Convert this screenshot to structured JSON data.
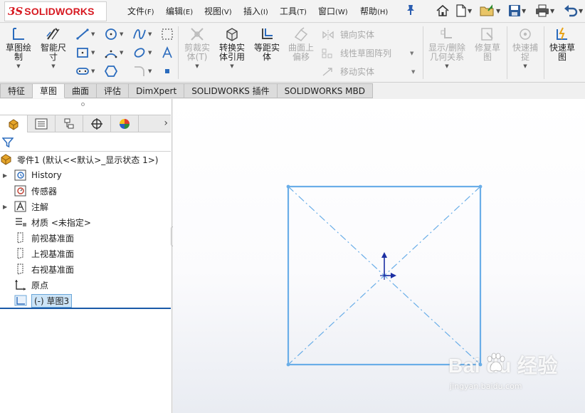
{
  "app": {
    "brand_prefix": "3S",
    "brand": "SOLIDWORKS"
  },
  "menu": [
    {
      "label": "文件",
      "accel": "(F)"
    },
    {
      "label": "编辑",
      "accel": "(E)"
    },
    {
      "label": "视图",
      "accel": "(V)"
    },
    {
      "label": "插入",
      "accel": "(I)"
    },
    {
      "label": "工具",
      "accel": "(T)"
    },
    {
      "label": "窗口",
      "accel": "(W)"
    },
    {
      "label": "帮助",
      "accel": "(H)"
    }
  ],
  "ribbon": {
    "sketch": "草图绘\n制",
    "smart_dim": "智能尺\n寸",
    "trim": "剪裁实\n体(T)",
    "convert": "转换实\n体引用",
    "offset": "等距实\n体",
    "offset_surface": "曲面上\n偏移",
    "mirror": "镜向实体",
    "linear_pattern": "线性草图阵列",
    "move": "移动实体",
    "display_delete": "显示/删除\n几何关系",
    "repair": "修复草\n图",
    "quick_snap": "快速捕\n捉",
    "rapid_sketch": "快速草\n图"
  },
  "tabs": [
    "特征",
    "草图",
    "曲面",
    "评估",
    "DimXpert",
    "SOLIDWORKS 插件",
    "SOLIDWORKS MBD"
  ],
  "active_tab": "草图",
  "tree": {
    "root": "零件1  (默认<<默认>_显示状态 1>)",
    "items": [
      {
        "label": "History",
        "expandable": true,
        "icon": "history-icon"
      },
      {
        "label": "传感器",
        "expandable": false,
        "icon": "sensor-icon"
      },
      {
        "label": "注解",
        "expandable": true,
        "icon": "annotation-icon"
      },
      {
        "label": "材质 <未指定>",
        "expandable": false,
        "icon": "material-icon"
      },
      {
        "label": "前视基准面",
        "expandable": false,
        "icon": "plane-icon"
      },
      {
        "label": "上视基准面",
        "expandable": false,
        "icon": "plane-icon"
      },
      {
        "label": "右视基准面",
        "expandable": false,
        "icon": "plane-icon"
      },
      {
        "label": "原点",
        "expandable": false,
        "icon": "origin-icon"
      },
      {
        "label": "(-) 草图3",
        "expandable": false,
        "icon": "sketch-icon",
        "selected": true
      }
    ]
  },
  "watermark": {
    "brand": "Bai  du 经验",
    "url": "jingyan.baidu.com"
  },
  "colors": {
    "sketch_line": "#6aaee8",
    "origin": "#1c2fa3",
    "brand_red": "#d71921",
    "selection": "#cce4f7"
  }
}
